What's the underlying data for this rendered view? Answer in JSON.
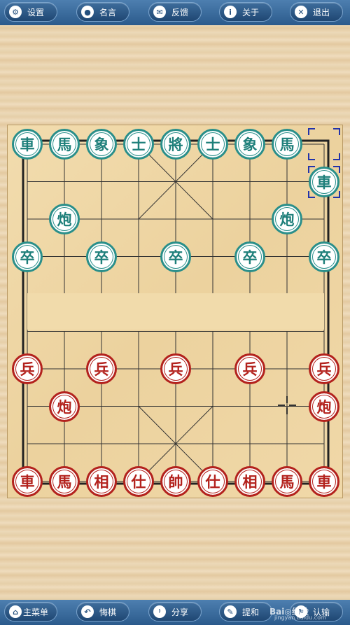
{
  "top_menu": [
    {
      "label": "设置",
      "icon": "gear-icon",
      "glyph": "⚙"
    },
    {
      "label": "名言",
      "icon": "speech-bubble-icon",
      "glyph": "●"
    },
    {
      "label": "反馈",
      "icon": "mail-icon",
      "glyph": "✉"
    },
    {
      "label": "关于",
      "icon": "info-icon",
      "glyph": "i"
    },
    {
      "label": "退出",
      "icon": "close-icon",
      "glyph": "✕"
    }
  ],
  "bottom_menu": [
    {
      "label": "主菜单",
      "icon": "home-icon",
      "glyph": "⌂"
    },
    {
      "label": "悔棋",
      "icon": "undo-icon",
      "glyph": "↶"
    },
    {
      "label": "分享",
      "icon": "rss-icon",
      "glyph": "⁾"
    },
    {
      "label": "提和",
      "icon": "pencil-icon",
      "glyph": "✎"
    },
    {
      "label": "认输",
      "icon": "flag-icon",
      "glyph": "⚑"
    }
  ],
  "board": {
    "river_text": "",
    "black_pieces": [
      {
        "char": "車",
        "col": 0,
        "row": 0
      },
      {
        "char": "馬",
        "col": 1,
        "row": 0
      },
      {
        "char": "象",
        "col": 2,
        "row": 0
      },
      {
        "char": "士",
        "col": 3,
        "row": 0
      },
      {
        "char": "將",
        "col": 4,
        "row": 0
      },
      {
        "char": "士",
        "col": 5,
        "row": 0
      },
      {
        "char": "象",
        "col": 6,
        "row": 0
      },
      {
        "char": "馬",
        "col": 7,
        "row": 0
      },
      {
        "char": "車",
        "col": 8,
        "row": 1
      },
      {
        "char": "炮",
        "col": 1,
        "row": 2
      },
      {
        "char": "炮",
        "col": 7,
        "row": 2
      },
      {
        "char": "卒",
        "col": 0,
        "row": 3
      },
      {
        "char": "卒",
        "col": 2,
        "row": 3
      },
      {
        "char": "卒",
        "col": 4,
        "row": 3
      },
      {
        "char": "卒",
        "col": 6,
        "row": 3
      },
      {
        "char": "卒",
        "col": 8,
        "row": 3
      }
    ],
    "red_pieces": [
      {
        "char": "兵",
        "col": 0,
        "row": 6
      },
      {
        "char": "兵",
        "col": 2,
        "row": 6
      },
      {
        "char": "兵",
        "col": 4,
        "row": 6
      },
      {
        "char": "兵",
        "col": 6,
        "row": 6
      },
      {
        "char": "兵",
        "col": 8,
        "row": 6
      },
      {
        "char": "炮",
        "col": 1,
        "row": 7
      },
      {
        "char": "炮",
        "col": 8,
        "row": 7
      },
      {
        "char": "車",
        "col": 0,
        "row": 9
      },
      {
        "char": "馬",
        "col": 1,
        "row": 9
      },
      {
        "char": "相",
        "col": 2,
        "row": 9
      },
      {
        "char": "仕",
        "col": 3,
        "row": 9
      },
      {
        "char": "帥",
        "col": 4,
        "row": 9
      },
      {
        "char": "仕",
        "col": 5,
        "row": 9
      },
      {
        "char": "相",
        "col": 6,
        "row": 9
      },
      {
        "char": "馬",
        "col": 7,
        "row": 9
      },
      {
        "char": "車",
        "col": 8,
        "row": 9
      }
    ],
    "last_move": {
      "from_col": 8,
      "from_row": 0,
      "to_col": 8,
      "to_row": 1
    },
    "target_marker": {
      "col": 7,
      "row": 7
    }
  },
  "watermark": {
    "text": "Bai◎经验",
    "sub": "jingyan.baidu.com"
  }
}
